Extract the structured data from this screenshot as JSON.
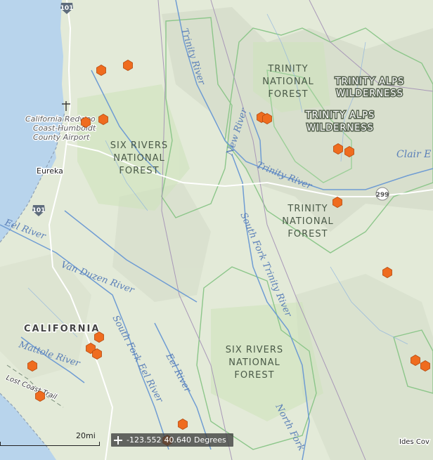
{
  "map": {
    "rivers": [
      "Trinity River",
      "New River",
      "Trinity River",
      "South Fork Trinity River",
      "Eel River",
      "Van Duzen River",
      "South Fork Eel River",
      "Mattole River",
      "Eel River",
      "North Fork"
    ],
    "forests": {
      "trinity_nf_1": [
        "TRINITY",
        "NATIONAL",
        "FOREST"
      ],
      "trinity_nf_2": [
        "TRINITY",
        "NATIONAL",
        "FOREST"
      ],
      "six_rivers_1": [
        "SIX RIVERS",
        "NATIONAL",
        "FOREST"
      ],
      "six_rivers_2": [
        "SIX RIVERS",
        "NATIONAL",
        "FOREST"
      ]
    },
    "wilderness": {
      "alps_1": [
        "TRINITY ALPS",
        "WILDERNESS"
      ],
      "alps_2": [
        "TRINITY ALPS",
        "WILDERNESS"
      ]
    },
    "towns": {
      "eureka": "Eureka",
      "ides_cove": "Ides Cov"
    },
    "places": {
      "airport": [
        "California Redwoo",
        "Coast-Humboldt",
        "County Airport"
      ],
      "clair": "Clair E"
    },
    "state": "CALIFORNIA",
    "trail": "Lost Coast Trail",
    "highways": [
      "101",
      "101",
      "299"
    ],
    "markers": [
      [
        144,
        100
      ],
      [
        182,
        93
      ],
      [
        122,
        174
      ],
      [
        147,
        170
      ],
      [
        372,
        167
      ],
      [
        380,
        169
      ],
      [
        481,
        212
      ],
      [
        497,
        216
      ],
      [
        480,
        288
      ],
      [
        551,
        388
      ],
      [
        141,
        480
      ],
      [
        129,
        496
      ],
      [
        138,
        504
      ],
      [
        46,
        521
      ],
      [
        57,
        564
      ],
      [
        591,
        513
      ],
      [
        605,
        521
      ],
      [
        260,
        604
      ],
      [
        238,
        627
      ]
    ],
    "colors": {
      "marker": "#ef6c1f",
      "water": "#b8d4ec",
      "land": "#dfe8d6",
      "boundary": "#8cc68a"
    }
  },
  "scale": {
    "label": "20mi"
  },
  "coords": {
    "lon": "-123.552",
    "lat": "40.640",
    "unit": "Degrees"
  }
}
